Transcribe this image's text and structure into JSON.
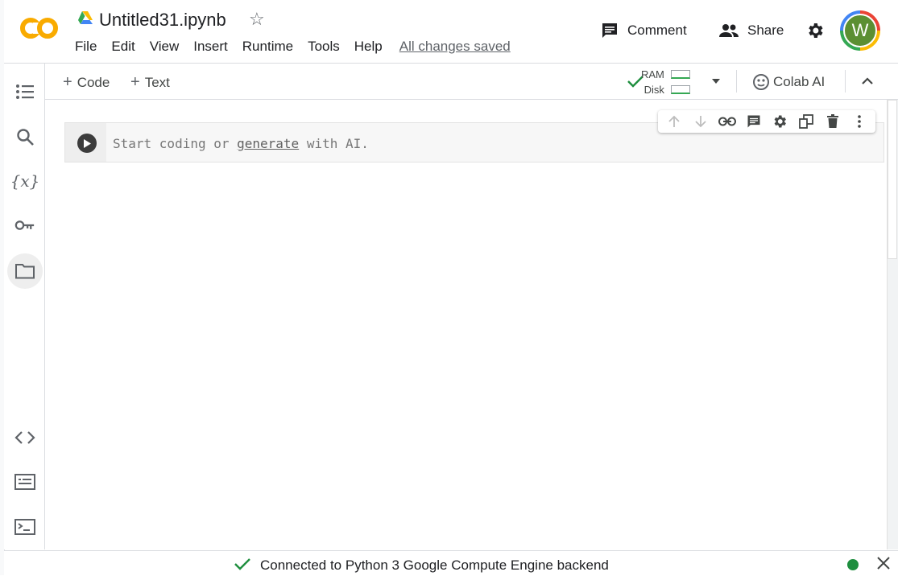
{
  "header": {
    "title": "Untitled31.ipynb",
    "logo_text": "CO",
    "menu": [
      "File",
      "Edit",
      "View",
      "Insert",
      "Runtime",
      "Tools",
      "Help"
    ],
    "save_status": "All changes saved",
    "comment_label": "Comment",
    "share_label": "Share",
    "avatar_initial": "W"
  },
  "toolbar": {
    "add_code_label": "Code",
    "add_text_label": "Text",
    "ram_label": "RAM",
    "disk_label": "Disk",
    "colab_ai_label": "Colab AI"
  },
  "sidebar": {
    "items": [
      "toc-icon",
      "search-icon",
      "variables-icon",
      "secrets-key-icon",
      "folder-icon",
      "code-snippets-icon",
      "command-palette-icon",
      "terminal-icon"
    ],
    "active_item": "folder-icon"
  },
  "cell": {
    "placeholder_before": "Start coding or ",
    "placeholder_link": "generate",
    "placeholder_after": " with AI."
  },
  "status": {
    "text": "Connected to Python 3 Google Compute Engine backend",
    "connected_color": "#1e8e3e"
  },
  "colors": {
    "logo_orange": "#f9ab00",
    "ok_green": "#34a853"
  }
}
